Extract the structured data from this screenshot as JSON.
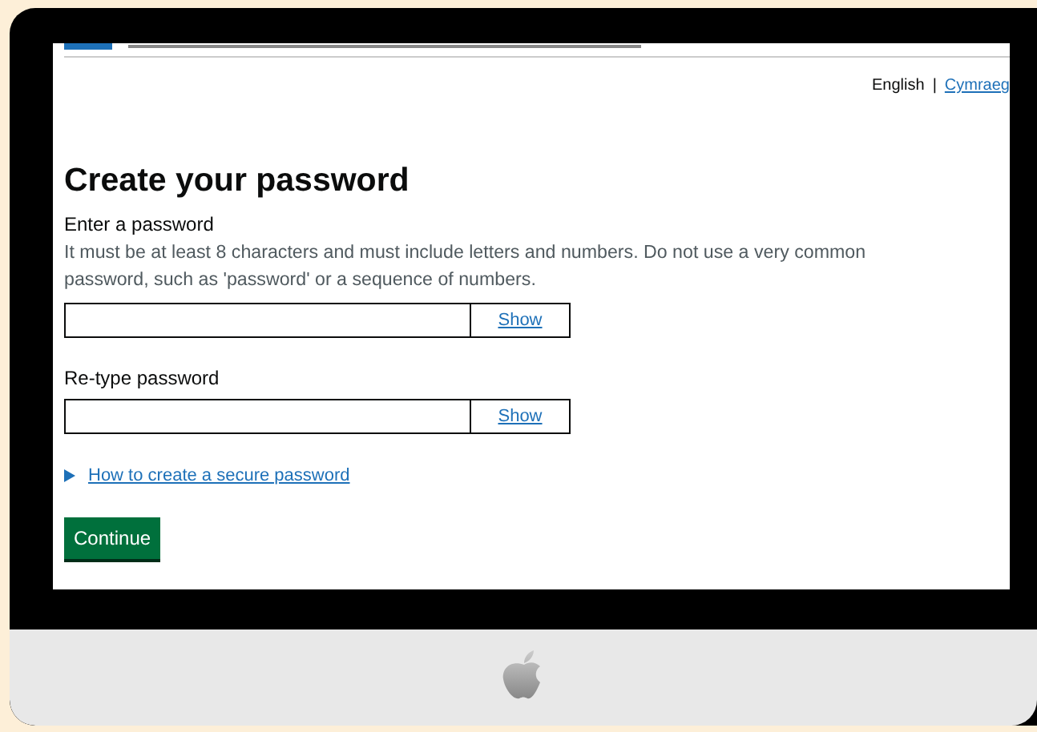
{
  "language_separator": "|",
  "languages": [
    {
      "label": "English",
      "selected": true
    },
    {
      "label": "Cymraeg",
      "selected": false
    }
  ],
  "title": "Create your password",
  "password": {
    "label": "Enter a password",
    "hint": "It must be at least 8 characters and must include letters and numbers. Do not use a very common password, such as 'password' or a sequence of numbers.",
    "toggle": "Show"
  },
  "retype": {
    "label": "Re-type password",
    "toggle": "Show"
  },
  "details": {
    "summary": "How to create a secure password",
    "expanded": false
  },
  "button": "Continue"
}
